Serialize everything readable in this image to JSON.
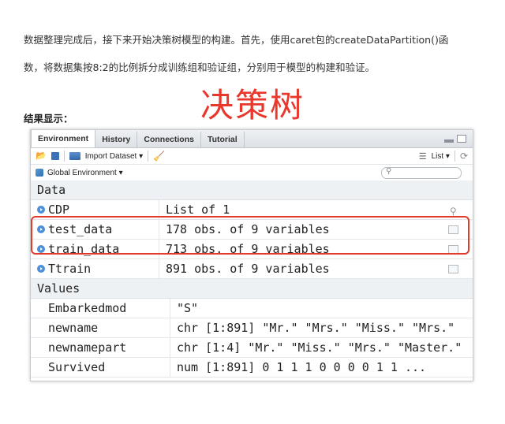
{
  "article": {
    "paragraph_1": "数据整理完成后，接下来开始决策树模型的构建。首先，使用caret包的createDataPartition()函",
    "paragraph_2": "数，将数据集按8:2的比例拆分成训练组和验证组，分别用于模型的构建和验证。",
    "big_title": "决策树",
    "result_label": "结果显示："
  },
  "rstudio": {
    "tabs": [
      {
        "label": "Environment",
        "active": true
      },
      {
        "label": "History",
        "active": false
      },
      {
        "label": "Connections",
        "active": false
      },
      {
        "label": "Tutorial",
        "active": false
      }
    ],
    "toolbar": {
      "import_label": "Import Dataset ▾",
      "view_label": "List ▾"
    },
    "env_selector": "Global Environment ▾",
    "search": {
      "placeholder": ""
    },
    "sections": {
      "data": "Data",
      "values": "Values"
    },
    "data_rows": [
      {
        "name": "CDP",
        "value": "List of 1"
      },
      {
        "name": "test_data",
        "value": "178 obs. of 9 variables"
      },
      {
        "name": "train_data",
        "value": "713 obs. of 9 variables"
      },
      {
        "name": "Ttrain",
        "value": "891 obs. of 9 variables"
      }
    ],
    "value_rows": [
      {
        "name": "Embarkedmod",
        "value": "\"S\""
      },
      {
        "name": "newname",
        "value": "chr [1:891] \"Mr.\" \"Mrs.\" \"Miss.\" \"Mrs.\" …"
      },
      {
        "name": "newnamepart",
        "value": "chr [1:4] \"Mr.\" \"Miss.\" \"Mrs.\" \"Master.\""
      },
      {
        "name": "Survived",
        "value": "num [1:891] 0 1 1 1 0 0 0 0 1 1 ..."
      }
    ],
    "colors": {
      "highlight": "#e23b2b",
      "title": "#e8372c"
    }
  }
}
